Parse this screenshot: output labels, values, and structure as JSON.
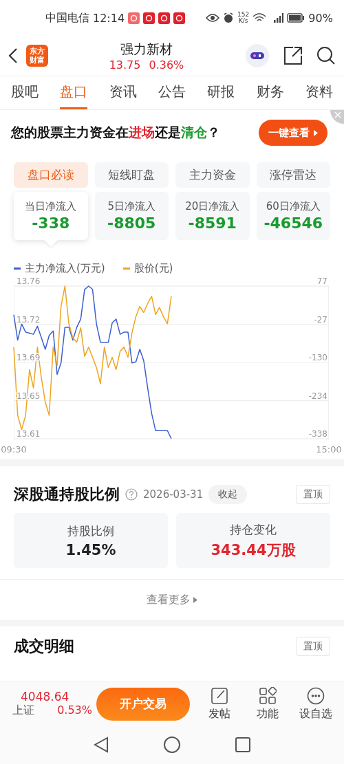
{
  "status_bar": {
    "carrier": "中国电信",
    "time": "12:14",
    "speed_value": "152",
    "speed_unit": "K/s",
    "battery": "90%"
  },
  "header": {
    "logo_lines": [
      "东方",
      "财富"
    ],
    "title": "强力新材",
    "price": "13.75",
    "change": "0.36%"
  },
  "tabs": [
    {
      "label": "股吧",
      "selected": false
    },
    {
      "label": "盘口",
      "selected": true
    },
    {
      "label": "资讯",
      "selected": false
    },
    {
      "label": "公告",
      "selected": false
    },
    {
      "label": "研报",
      "selected": false
    },
    {
      "label": "财务",
      "selected": false
    },
    {
      "label": "资料",
      "selected": false
    }
  ],
  "banner": {
    "segments": [
      {
        "text": "您的股票主力资金在",
        "color": "#111111"
      },
      {
        "text": "进场",
        "color": "#e0262f"
      },
      {
        "text": "还是",
        "color": "#111111"
      },
      {
        "text": "清仓",
        "color": "#1a9a2e"
      },
      {
        "text": "？",
        "color": "#111111"
      }
    ],
    "button": "一键查看"
  },
  "sub_tabs": [
    {
      "label": "盘口必读",
      "selected": true
    },
    {
      "label": "短线盯盘",
      "selected": false
    },
    {
      "label": "主力资金",
      "selected": false
    },
    {
      "label": "涨停雷达",
      "selected": false
    }
  ],
  "flow_cards": [
    {
      "label": "当日净流入",
      "value": "-338",
      "selected": true
    },
    {
      "label": "5日净流入",
      "value": "-8805",
      "selected": false
    },
    {
      "label": "20日净流入",
      "value": "-8591",
      "selected": false
    },
    {
      "label": "60日净流入",
      "value": "-46546",
      "selected": false
    }
  ],
  "chart": {
    "chart_data": {
      "type": "line",
      "grid": true,
      "categories": [
        "09:30",
        null,
        null,
        null,
        null,
        null,
        null,
        null,
        null,
        null,
        null,
        null,
        null,
        null,
        null,
        null,
        null,
        null,
        null,
        null,
        null,
        null,
        null,
        null,
        null,
        null,
        null,
        null,
        null,
        null,
        null,
        null,
        null,
        null,
        null,
        null,
        null,
        null,
        null,
        null,
        null,
        null,
        null,
        null,
        null,
        null,
        null,
        null,
        null,
        null,
        null,
        null,
        null,
        null,
        null,
        null,
        null,
        null,
        null,
        null,
        null,
        null,
        null,
        null,
        null,
        null,
        null,
        null,
        null,
        null,
        null,
        null,
        null,
        null,
        null,
        null,
        null,
        null,
        null,
        null,
        "15:00"
      ],
      "ylim": [
        13.61,
        13.76
      ],
      "yticks": [
        {
          "value": 13.76,
          "label": "13.76"
        },
        {
          "value": 13.7225,
          "label": "13.72"
        },
        {
          "value": 13.685,
          "label": "13.69"
        },
        {
          "value": 13.6475,
          "label": "13.65"
        },
        {
          "value": 13.61,
          "label": "13.61"
        }
      ],
      "y2lim": [
        -338,
        77
      ],
      "y2ticks": [
        {
          "value": 77,
          "label": "77"
        },
        {
          "value": -26.75,
          "label": "-27"
        },
        {
          "value": -130.5,
          "label": "-130"
        },
        {
          "value": -234.25,
          "label": "-234"
        },
        {
          "value": -338,
          "label": "-338"
        }
      ],
      "series": [
        {
          "name": "主力净流入(万元)",
          "color": "#3d5fd0",
          "axis": "y2",
          "values": [
            -1,
            -70,
            -26,
            -48,
            -51,
            -54,
            -32,
            -63,
            -95,
            -57,
            -45,
            -163,
            -132,
            -35,
            -35,
            -70,
            -35,
            -13,
            68,
            77,
            68,
            -26,
            -76,
            -76,
            -76,
            -23,
            -13,
            -54,
            -48,
            -48,
            -132,
            -129,
            -95,
            -126,
            -201,
            -269,
            -316,
            -316,
            -316,
            -316,
            -338,
            null,
            null,
            null,
            null,
            null,
            null,
            null,
            null,
            null,
            null,
            null,
            null,
            null,
            null,
            null,
            null,
            null,
            null,
            null,
            null,
            null,
            null,
            null,
            null,
            null,
            null,
            null,
            null,
            null,
            null,
            null,
            null,
            null,
            null,
            null,
            null,
            null,
            null,
            null,
            null
          ]
        },
        {
          "name": "股价(元)",
          "color": "#f0a520",
          "values": [
            13.7,
            13.633,
            13.619,
            13.633,
            13.678,
            13.66,
            13.7,
            13.67,
            13.646,
            13.633,
            13.7,
            13.682,
            13.74,
            13.76,
            13.723,
            13.709,
            13.705,
            13.719,
            13.691,
            13.7,
            13.69,
            13.68,
            13.664,
            13.7,
            13.68,
            13.69,
            13.678,
            13.696,
            13.7,
            13.69,
            13.714,
            13.73,
            13.74,
            13.734,
            13.743,
            13.75,
            13.732,
            13.739,
            13.73,
            13.723,
            13.75,
            null,
            null,
            null,
            null,
            null,
            null,
            null,
            null,
            null,
            null,
            null,
            null,
            null,
            null,
            null,
            null,
            null,
            null,
            null,
            null,
            null,
            null,
            null,
            null,
            null,
            null,
            null,
            null,
            null,
            null,
            null,
            null,
            null,
            null,
            null,
            null,
            null,
            null,
            null,
            null
          ]
        }
      ]
    }
  },
  "holding": {
    "title": "深股通持股比例",
    "date": "2026-03-31",
    "collapse": "收起",
    "pin": "置顶",
    "cards": [
      {
        "label": "持股比例",
        "value": "1.45%",
        "color": "#222222"
      },
      {
        "label": "持仓变化",
        "value": "343.44万股",
        "color": "#e0262f"
      }
    ],
    "more": "查看更多"
  },
  "deals": {
    "title": "成交明细",
    "pin": "置顶"
  },
  "bottom_bar": {
    "index_value": "4048.64",
    "index_name": "上证",
    "index_change": "0.53%",
    "trade_button": "开户交易",
    "actions": [
      {
        "kind": "post",
        "label": "发帖"
      },
      {
        "kind": "functions",
        "label": "功能"
      },
      {
        "kind": "watch",
        "label": "设自选"
      }
    ]
  }
}
